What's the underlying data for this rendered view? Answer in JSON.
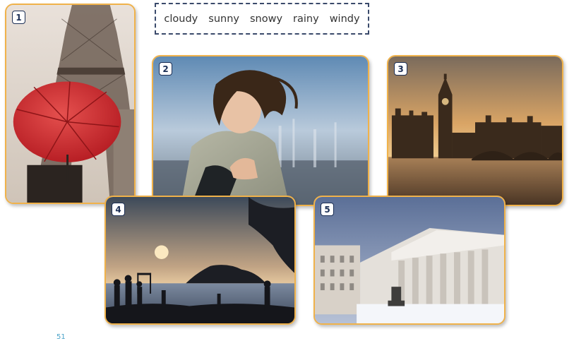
{
  "word_bank": [
    "cloudy",
    "sunny",
    "snowy",
    "rainy",
    "windy"
  ],
  "photos": [
    {
      "number": "1",
      "subject": "umbrella-eiffel-tower"
    },
    {
      "number": "2",
      "subject": "woman-windy-hair"
    },
    {
      "number": "3",
      "subject": "big-ben-sunset"
    },
    {
      "number": "4",
      "subject": "beach-sunset"
    },
    {
      "number": "5",
      "subject": "snowy-building"
    }
  ],
  "page_number": "51",
  "colors": {
    "card_border": "#f0b24a",
    "badge": "#1c2f55",
    "box_border": "#3a4a6b",
    "page_number": "#4aa3c8"
  }
}
